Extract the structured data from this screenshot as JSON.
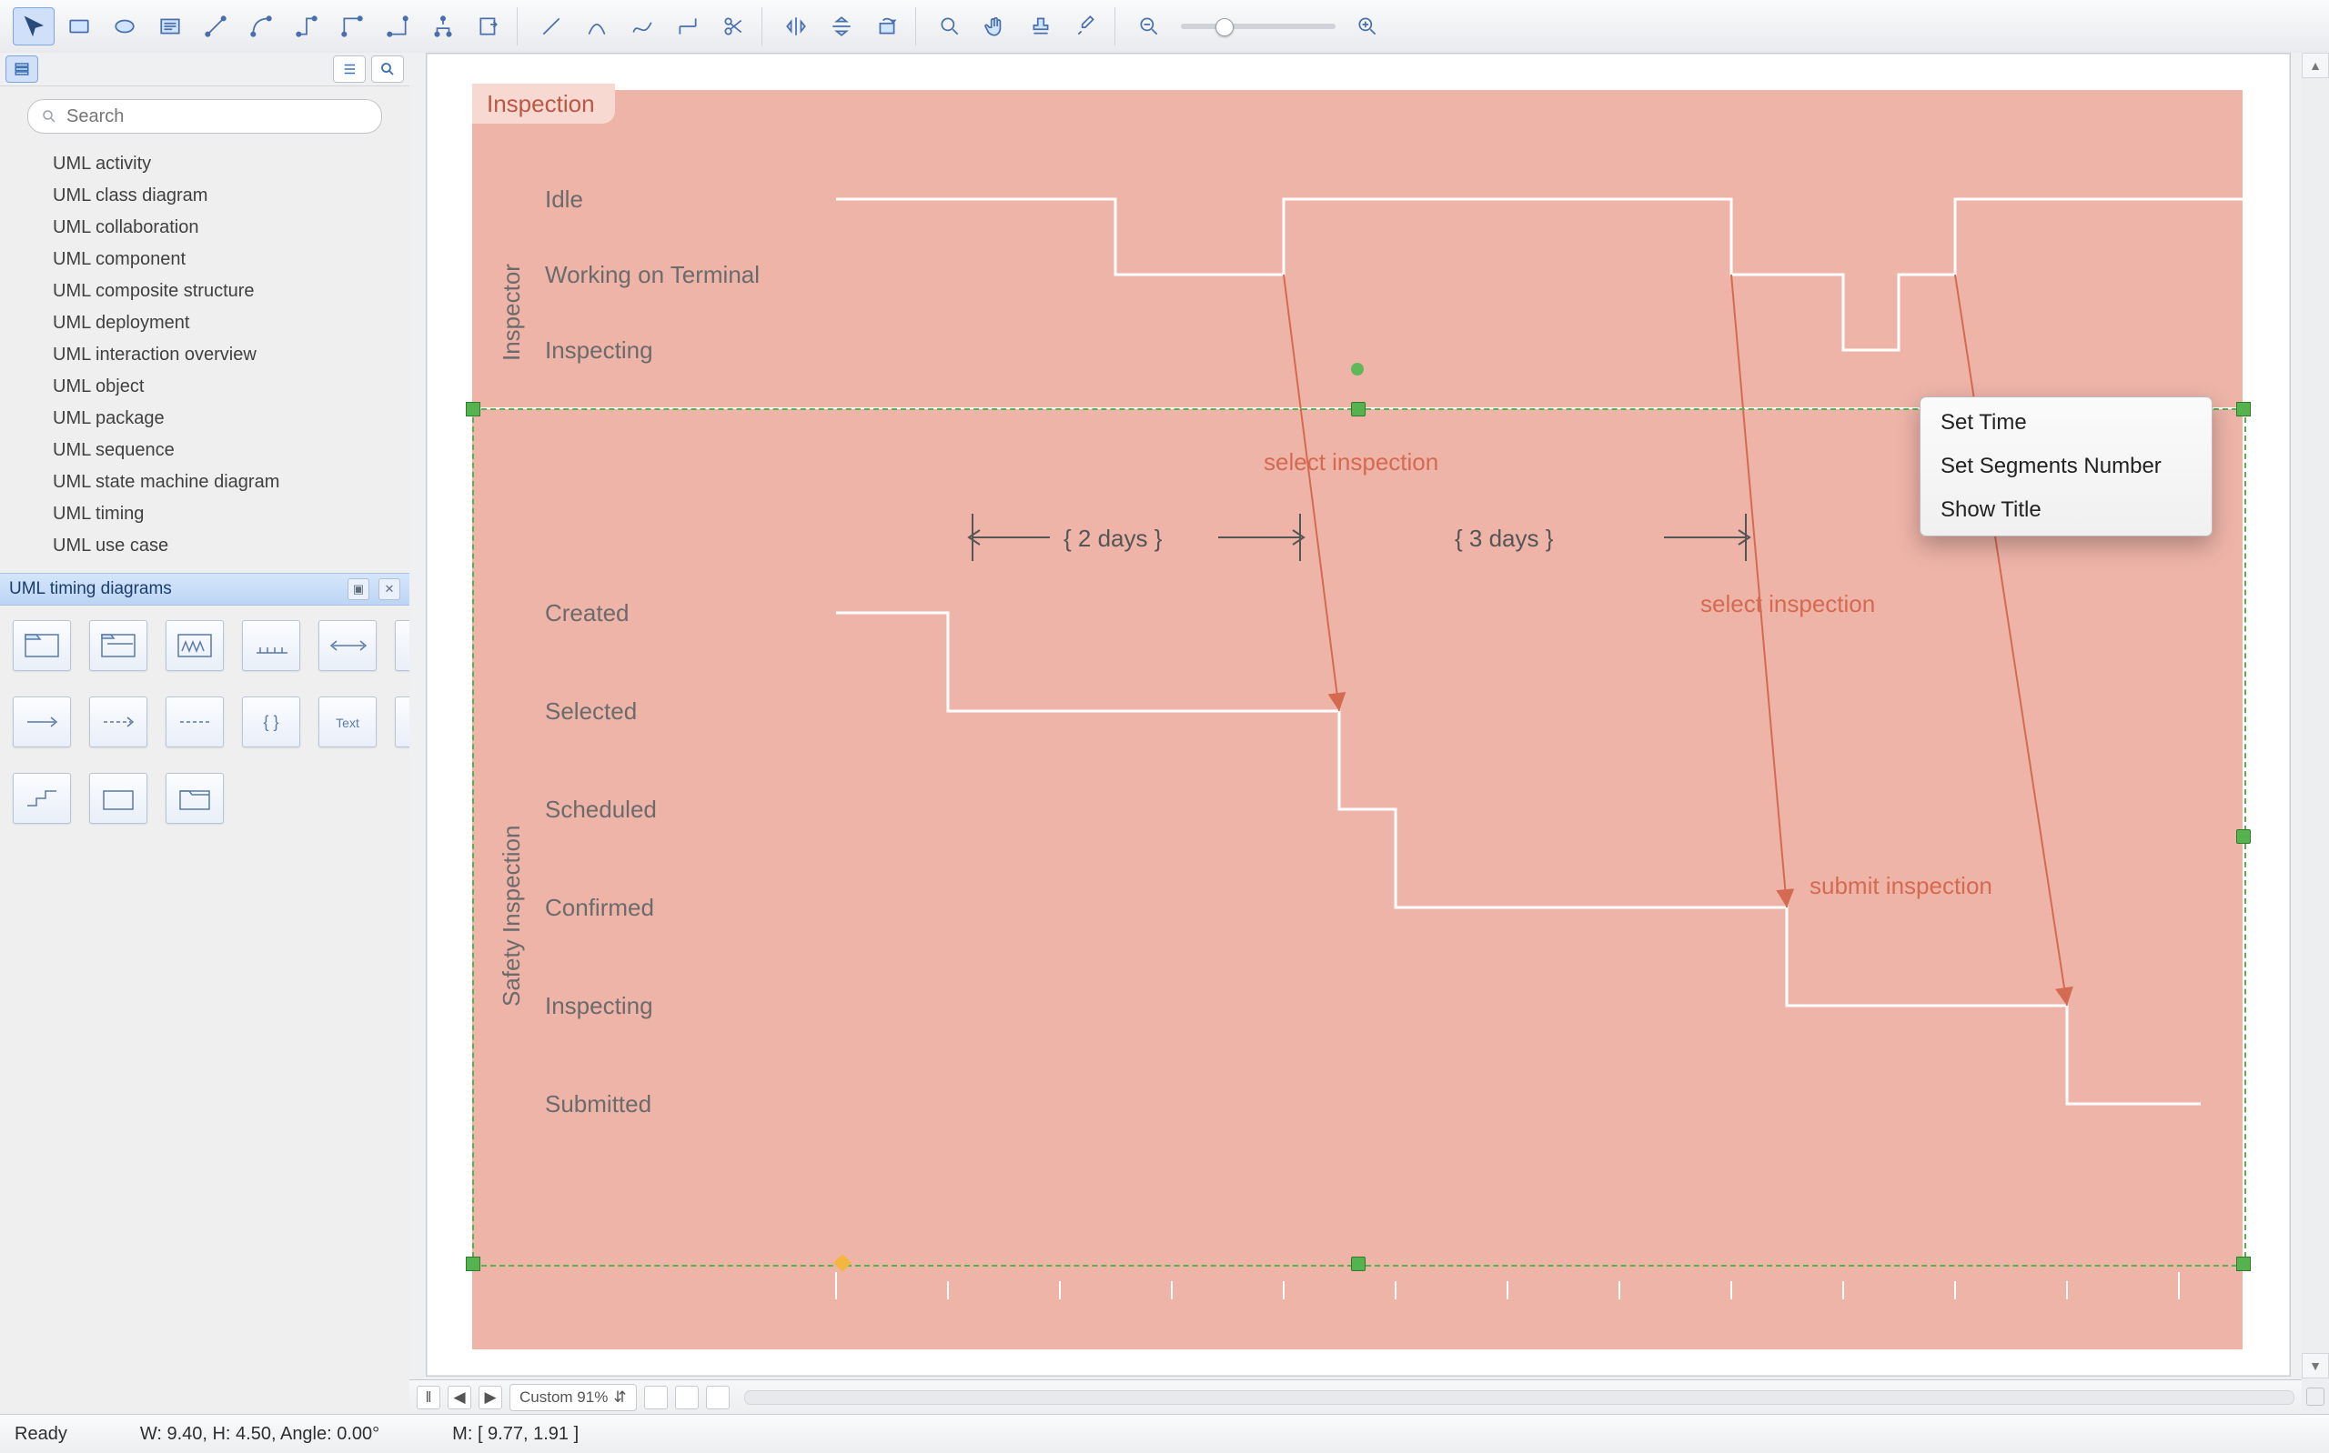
{
  "toolbar": {
    "tools": [
      {
        "name": "pointer",
        "active": true
      },
      {
        "name": "rect"
      },
      {
        "name": "ellipse"
      },
      {
        "name": "text-box"
      },
      {
        "name": "connector-1"
      },
      {
        "name": "connector-2"
      },
      {
        "name": "connector-3"
      },
      {
        "name": "connector-4"
      },
      {
        "name": "connector-5"
      },
      {
        "name": "tree-connector"
      },
      {
        "name": "export"
      }
    ],
    "tools2": [
      {
        "name": "line"
      },
      {
        "name": "arc"
      },
      {
        "name": "spline"
      },
      {
        "name": "bezier"
      },
      {
        "name": "scissors"
      }
    ],
    "tools3": [
      {
        "name": "flip-h"
      },
      {
        "name": "flip-v"
      },
      {
        "name": "rotate"
      }
    ],
    "tools4": [
      {
        "name": "zoom-tool"
      },
      {
        "name": "hand-tool"
      },
      {
        "name": "stamp"
      },
      {
        "name": "eyedropper"
      }
    ],
    "tools5": [
      {
        "name": "zoom-out"
      },
      {
        "name": "zoom-slider"
      },
      {
        "name": "zoom-in"
      }
    ]
  },
  "sidebar": {
    "search_placeholder": "Search",
    "library_items": [
      "UML activity",
      "UML class diagram",
      "UML collaboration",
      "UML component",
      "UML composite structure",
      "UML deployment",
      "UML interaction overview",
      "UML object",
      "UML package",
      "UML sequence",
      "UML state machine diagram",
      "UML timing",
      "UML use case"
    ],
    "open_library": "UML timing diagrams",
    "shapes": [
      "timing-frame",
      "state-lifeline",
      "value-lifeline",
      "tick-ruler",
      "two-way",
      "dim-left",
      "arrow",
      "dashed-arrow",
      "dashed-line",
      "braces",
      "text",
      "crossover",
      "step",
      "folder",
      "folder-open"
    ]
  },
  "diagram": {
    "title": "Inspection",
    "axisStart": 0,
    "axisEnd": 12,
    "inspector": {
      "name": "Inspector",
      "states": [
        "Idle",
        "Working on Terminal",
        "Inspecting"
      ]
    },
    "safety": {
      "name": "Safety Inspection",
      "states": [
        "Created",
        "Selected",
        "Scheduled",
        "Confirmed",
        "Inspecting",
        "Submitted"
      ]
    },
    "durations": [
      {
        "label": "{ 2 days }"
      },
      {
        "label": "{ 3 days }"
      }
    ],
    "messages": [
      {
        "label": "select inspection"
      },
      {
        "label": "select inspection"
      },
      {
        "label": "submit inspection"
      }
    ]
  },
  "context_menu": {
    "items": [
      "Set Time",
      "Set Segments Number",
      "Show Title"
    ]
  },
  "docbar": {
    "zoom_label": "Custom 91%"
  },
  "status": {
    "ready": "Ready",
    "dims": "W: 9.40,  H: 4.50,  Angle: 0.00°",
    "mouse": "M: [ 9.77, 1.91 ]"
  },
  "chart_data": {
    "type": "timing-diagram",
    "title": "Inspection",
    "time_axis": {
      "start": 0,
      "end": 12,
      "step": 1,
      "unit": "days"
    },
    "lifelines": [
      {
        "name": "Inspector",
        "states": [
          "Idle",
          "Working on Terminal",
          "Inspecting"
        ],
        "segments": [
          {
            "from": 0,
            "to": 2.5,
            "state": "Idle"
          },
          {
            "from": 2.5,
            "to": 4,
            "state": "Working on Terminal"
          },
          {
            "from": 4,
            "to": 8,
            "state": "Idle"
          },
          {
            "from": 8,
            "to": 9,
            "state": "Working on Terminal"
          },
          {
            "from": 9,
            "to": 9.5,
            "state": "Inspecting"
          },
          {
            "from": 9.5,
            "to": 10,
            "state": "Working on Terminal"
          },
          {
            "from": 10,
            "to": 12,
            "state": "Idle"
          }
        ]
      },
      {
        "name": "Safety Inspection",
        "states": [
          "Created",
          "Selected",
          "Scheduled",
          "Confirmed",
          "Inspecting",
          "Submitted"
        ],
        "segments": [
          {
            "from": 0,
            "to": 1,
            "state": "Created"
          },
          {
            "from": 1,
            "to": 4.5,
            "state": "Selected"
          },
          {
            "from": 4.5,
            "to": 5,
            "state": "Scheduled"
          },
          {
            "from": 5,
            "to": 8.5,
            "state": "Confirmed"
          },
          {
            "from": 8.5,
            "to": 11,
            "state": "Inspecting"
          },
          {
            "from": 11,
            "to": 12,
            "state": "Submitted"
          }
        ]
      }
    ],
    "duration_constraints": [
      {
        "from": 1,
        "to": 4,
        "label": "{ 2 days }"
      },
      {
        "from": 4,
        "to": 8,
        "label": "{ 3 days }"
      }
    ],
    "messages": [
      {
        "label": "select inspection",
        "from_lifeline": "Inspector",
        "to_lifeline": "Safety Inspection",
        "from_time": 4,
        "to_time": 4.5
      },
      {
        "label": "select inspection",
        "from_lifeline": "Inspector",
        "to_lifeline": "Safety Inspection",
        "from_time": 8,
        "to_time": 8.5
      },
      {
        "label": "submit inspection",
        "from_lifeline": "Inspector",
        "to_lifeline": "Safety Inspection",
        "from_time": 10,
        "to_time": 11
      }
    ]
  }
}
